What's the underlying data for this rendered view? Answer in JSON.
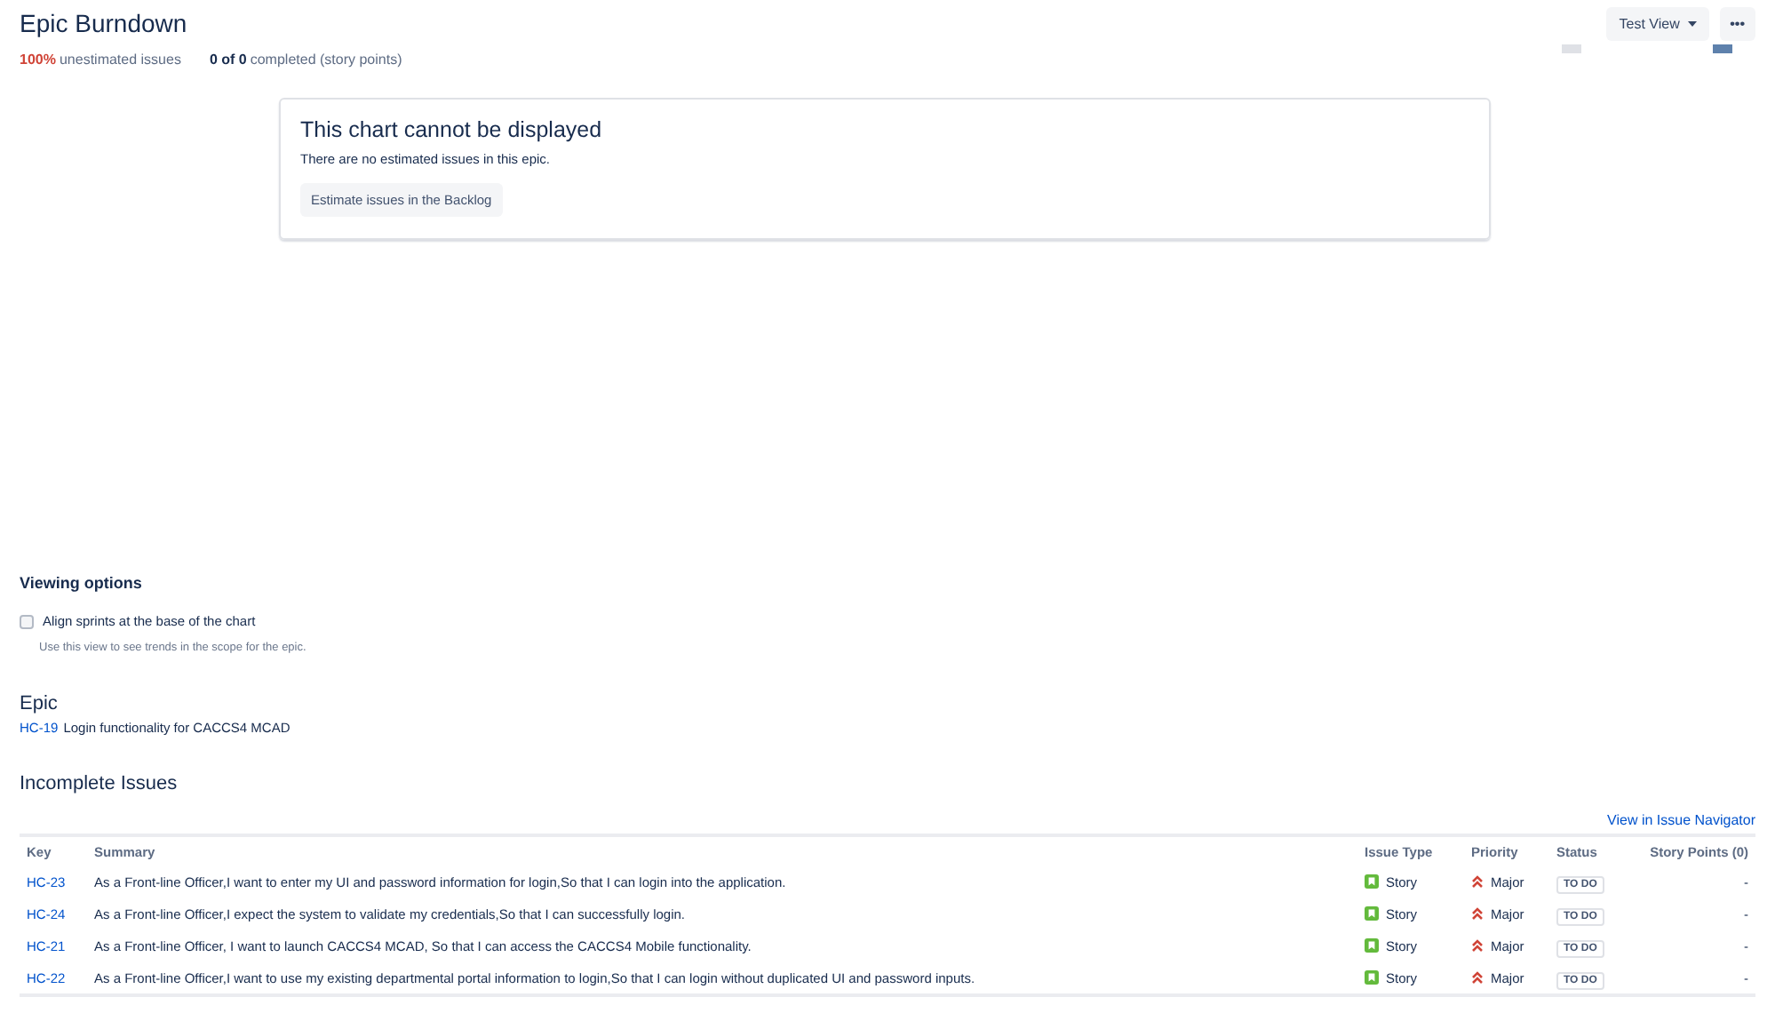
{
  "header": {
    "title": "Epic Burndown",
    "view_button": "Test View",
    "more_button": "•••"
  },
  "stats": [
    {
      "value": "100%",
      "label": "unestimated issues",
      "kind": "warning"
    },
    {
      "value": "0 of 0",
      "label": "completed (story points)",
      "kind": "plain"
    }
  ],
  "legend": [
    {
      "color": "#dfe1e6"
    },
    {
      "color": "#5e81ac"
    }
  ],
  "message": {
    "title": "This chart cannot be displayed",
    "text": "There are no estimated issues in this epic.",
    "button": "Estimate issues in the Backlog"
  },
  "viewing_options": {
    "title": "Viewing options",
    "option": {
      "label": "Align sprints at the base of the chart",
      "checked": false,
      "help": "Use this view to see trends in the scope for the epic."
    }
  },
  "epic": {
    "title": "Epic",
    "key": "HC-19",
    "name": "Login functionality for CACCS4 MCAD"
  },
  "incomplete": {
    "title": "Incomplete Issues",
    "navigator_link": "View in Issue Navigator",
    "columns": [
      "Key",
      "Summary",
      "Issue Type",
      "Priority",
      "Status",
      "Story Points (0)"
    ],
    "rows": [
      {
        "key": "HC-23",
        "summary": "As a Front-line Officer,I want to enter my UI and password information for login,So that I can login into the application.",
        "type": "Story",
        "priority": "Major",
        "status": "TO DO",
        "points": "-"
      },
      {
        "key": "HC-24",
        "summary": "As a Front-line Officer,I expect the system to validate my credentials,So that I can successfully login.",
        "type": "Story",
        "priority": "Major",
        "status": "TO DO",
        "points": "-"
      },
      {
        "key": "HC-21",
        "summary": "As a Front-line Officer, I want to launch CACCS4 MCAD, So that I can access the CACCS4 Mobile functionality.",
        "type": "Story",
        "priority": "Major",
        "status": "TO DO",
        "points": "-"
      },
      {
        "key": "HC-22",
        "summary": "As a Front-line Officer,I want to use my existing departmental portal information to login,So that I can login without duplicated UI and password inputs.",
        "type": "Story",
        "priority": "Major",
        "status": "TO DO",
        "points": "-"
      }
    ]
  }
}
